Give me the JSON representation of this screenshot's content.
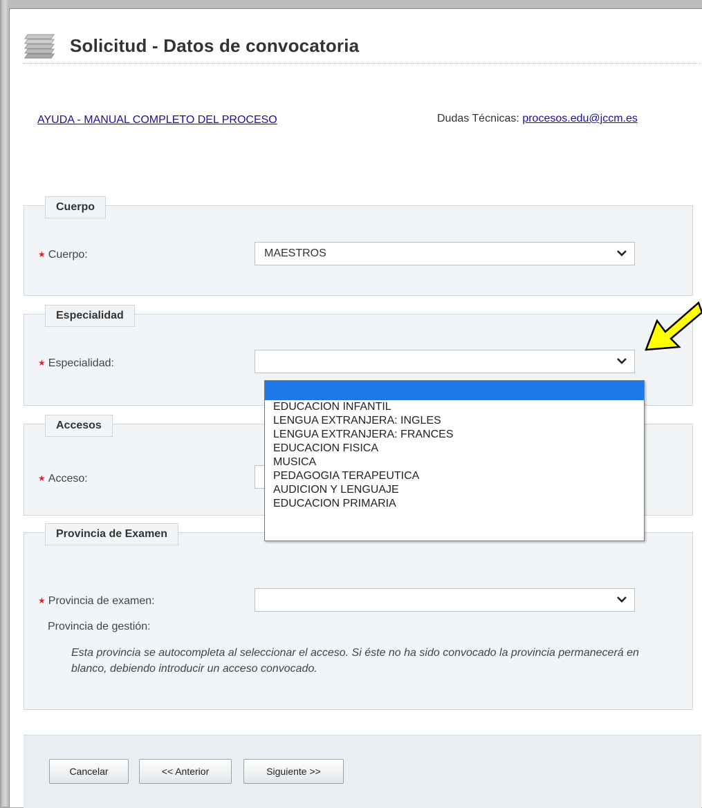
{
  "header": {
    "title": "Solicitud - Datos de convocatoria",
    "icon": "stacked-papers-icon"
  },
  "help_link": "AYUDA - MANUAL COMPLETO DEL PROCESO",
  "tech_support": {
    "label": "Dudas Técnicas:",
    "email": "procesos.edu@jccm.es"
  },
  "sections": {
    "cuerpo": {
      "legend": "Cuerpo",
      "label": "Cuerpo:",
      "value": "MAESTROS"
    },
    "especialidad": {
      "legend": "Especialidad",
      "label": "Especialidad:",
      "value": ""
    },
    "accesos": {
      "legend": "Accesos",
      "label": "Acceso:",
      "value": ""
    },
    "provincia": {
      "legend": "Provincia de Examen",
      "label": "Provincia de examen:",
      "value": "",
      "gestion_label": "Provincia de gestión:",
      "note": "Esta provincia se autocompleta al seleccionar el acceso. Si éste no ha sido convocado la provincia permanecerá en blanco, debiendo introducir un acceso convocado."
    }
  },
  "especialidad_options": [
    "",
    "EDUCACION INFANTIL",
    "LENGUA EXTRANJERA: INGLES",
    "LENGUA EXTRANJERA: FRANCES",
    "EDUCACION FISICA",
    "MUSICA",
    "PEDAGOGIA TERAPEUTICA",
    "AUDICION Y LENGUAJE",
    "EDUCACION PRIMARIA"
  ],
  "buttons": {
    "cancel": "Cancelar",
    "previous": "<< Anterior",
    "next": "Siguiente >>"
  },
  "colors": {
    "required_marker": "#d9232d",
    "link": "#1a0dab",
    "selected_option": "#1e78e6",
    "annotation_arrow": "#ffff00"
  }
}
